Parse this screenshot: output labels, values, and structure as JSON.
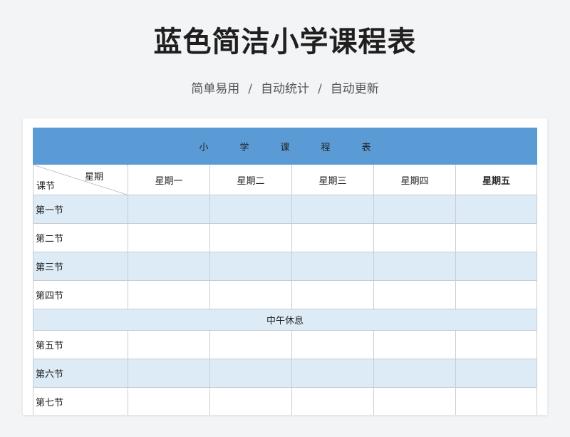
{
  "page": {
    "title": "蓝色简洁小学课程表",
    "subtitle": [
      "简单易用",
      "自动统计",
      "自动更新"
    ],
    "subtitle_separator": "/"
  },
  "table": {
    "banner_chars": [
      "小",
      "学",
      "课",
      "程",
      "表"
    ],
    "corner_top": "星期",
    "corner_bottom": "课节",
    "days": [
      "星期一",
      "星期二",
      "星期三",
      "星期四",
      "星期五"
    ],
    "periods": [
      "第一节",
      "第二节",
      "第三节",
      "第四节",
      "第五节",
      "第六节",
      "第七节"
    ],
    "lunch": "中午休息"
  },
  "colors": {
    "banner": "#5b9bd5",
    "shade": "#ddebf7",
    "background": "#f3f4f6"
  }
}
